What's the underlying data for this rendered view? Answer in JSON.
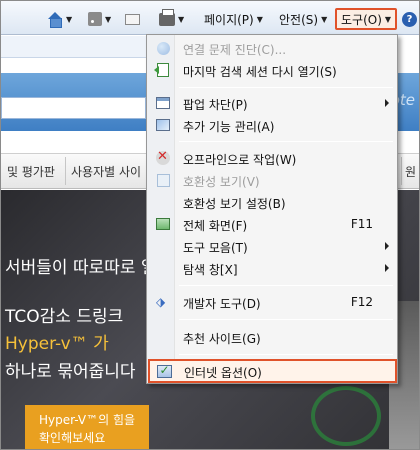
{
  "command_bar": {
    "page_label": "페이지(P)",
    "safety_label": "안전(S)",
    "tools_label": "도구(O)",
    "help_label": "?"
  },
  "background_page": {
    "banner_text": "ote",
    "tabs": [
      "및 평가판",
      "사용자별 사이",
      "원"
    ],
    "hero_lines": [
      "서버들이 따로따로 일",
      "TCO감소 드링크",
      "Hyper-v™ 가",
      "하나로 묶어줍니다"
    ],
    "promo_lines": [
      "Hyper-V™의 힘을",
      "확인해보세요"
    ]
  },
  "tools_menu": {
    "items": [
      {
        "label": "연결 문제 진단(C)...",
        "shortcut": "",
        "submenu": false,
        "disabled": true,
        "icon": "diagnose-globe-icon"
      },
      {
        "label": "마지막 검색 세션 다시 열기(S)",
        "shortcut": "",
        "submenu": false,
        "disabled": false,
        "icon": "reopen-session-icon"
      },
      {
        "label": "팝업 차단(P)",
        "shortcut": "",
        "submenu": true,
        "disabled": false,
        "icon": "popup-blocker-icon"
      },
      {
        "label": "추가 기능 관리(A)",
        "shortcut": "",
        "submenu": false,
        "disabled": false,
        "icon": "manage-addons-icon"
      },
      {
        "label": "오프라인으로 작업(W)",
        "shortcut": "",
        "submenu": false,
        "disabled": false,
        "icon": "offline-icon"
      },
      {
        "label": "호환성 보기(V)",
        "shortcut": "",
        "submenu": false,
        "disabled": true,
        "icon": "compatibility-view-icon"
      },
      {
        "label": "호환성 보기 설정(B)",
        "shortcut": "",
        "submenu": false,
        "disabled": false,
        "icon": ""
      },
      {
        "label": "전체 화면(F)",
        "shortcut": "F11",
        "submenu": false,
        "disabled": false,
        "icon": "fullscreen-icon"
      },
      {
        "label": "도구 모음(T)",
        "shortcut": "",
        "submenu": true,
        "disabled": false,
        "icon": ""
      },
      {
        "label": "탐색 창[X]",
        "shortcut": "",
        "submenu": true,
        "disabled": false,
        "icon": ""
      },
      {
        "label": "개발자 도구(D)",
        "shortcut": "F12",
        "submenu": false,
        "disabled": false,
        "icon": "developer-tools-icon"
      },
      {
        "label": "추천 사이트(G)",
        "shortcut": "",
        "submenu": false,
        "disabled": false,
        "icon": ""
      },
      {
        "label": "인터넷 옵션(O)",
        "shortcut": "",
        "submenu": false,
        "disabled": false,
        "icon": "internet-options-icon"
      }
    ]
  },
  "colors": {
    "highlight_border": "#e0522a",
    "menu_bg": "#f5f5f5",
    "disabled_text": "#9d9d9d"
  }
}
